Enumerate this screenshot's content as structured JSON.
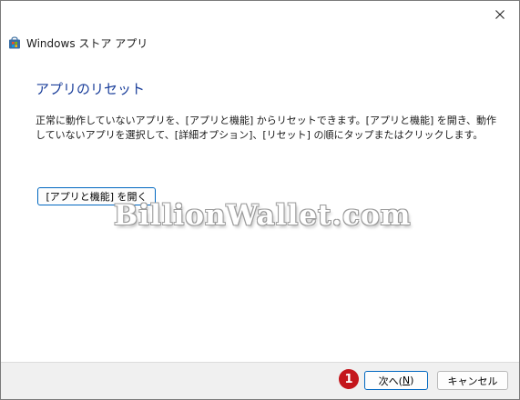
{
  "window": {
    "title": "Windows ストア アプリ"
  },
  "content": {
    "heading": "アプリのリセット",
    "description": "正常に動作していないアプリを、[アプリと機能] からリセットできます。[アプリと機能] を開き、動作していないアプリを選択して、[詳細オプション]、[リセット] の順にタップまたはクリックします。",
    "open_button_label": "[アプリと機能] を開く"
  },
  "watermark": "BillionWallet.com",
  "footer": {
    "step_badge": "1",
    "next_label_prefix": "次へ(",
    "next_label_key": "N",
    "next_label_suffix": ")",
    "cancel_label": "キャンセル"
  },
  "colors": {
    "heading": "#1a3e9a",
    "accent_border": "#0067c0",
    "badge": "#c4161c",
    "footer_bg": "#f0f0f0"
  },
  "icons": {
    "close": "close-icon",
    "app": "store-app-icon"
  }
}
